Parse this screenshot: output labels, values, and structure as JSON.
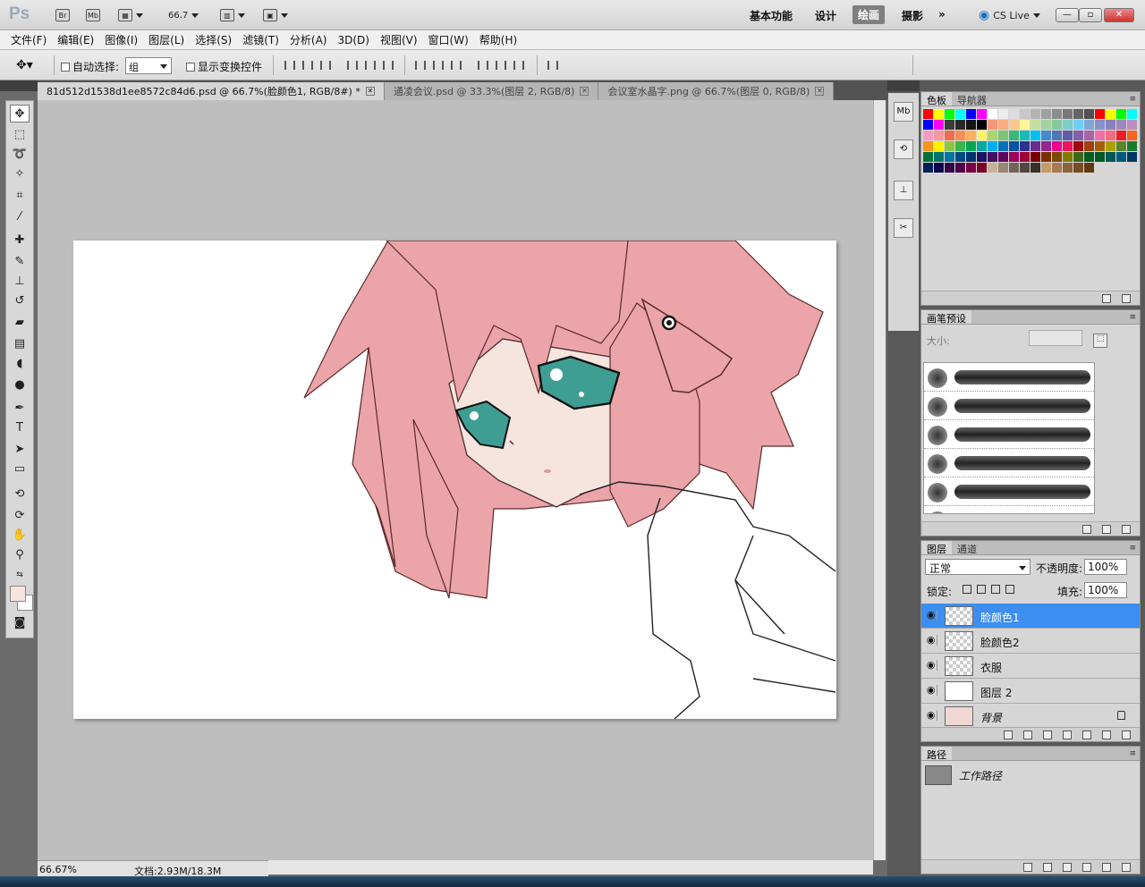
{
  "app": {
    "logo": "Ps"
  },
  "appbar": {
    "bridge": "Br",
    "minibridge": "Mb",
    "zoom": "66.7",
    "workspaces": [
      "基本功能",
      "设计",
      "绘画",
      "摄影"
    ],
    "active_workspace": "绘画",
    "more": "»",
    "cslive": "CS Live",
    "min": "—",
    "restore": "▫",
    "close": "✕"
  },
  "menu": [
    "文件(F)",
    "编辑(E)",
    "图像(I)",
    "图层(L)",
    "选择(S)",
    "滤镜(T)",
    "分析(A)",
    "3D(D)",
    "视图(V)",
    "窗口(W)",
    "帮助(H)"
  ],
  "options": {
    "auto_select_label": "自动选择:",
    "auto_select_value": "组",
    "show_transform_label": "显示变换控件"
  },
  "tabs": [
    {
      "label": "81d512d1538d1ee8572c84d6.psd @ 66.7%(脸颜色1, RGB/8#) *",
      "active": true
    },
    {
      "label": "通凌会议.psd @ 33.3%(图层 2, RGB/8)",
      "active": false
    },
    {
      "label": "会议室水晶字.png @ 66.7%(图层 0, RGB/8)",
      "active": false
    }
  ],
  "status": {
    "zoom": "66.67%",
    "doc": "文档:2.93M/18.3M"
  },
  "colors": {
    "hair": "#eba4a8",
    "skin": "#f6e4de",
    "eye": "#3f9e94",
    "selection": "#3d8ef0",
    "foreground": "#f6e4de"
  },
  "panels": {
    "swatches_tab": "色板",
    "navigator_tab": "导航器",
    "brush_tab": "画笔预设",
    "brush_size_label": "大小:",
    "layers_tab": "图层",
    "channels_tab": "通道",
    "blend_mode": "正常",
    "opacity_label": "不透明度:",
    "opacity": "100%",
    "lock_label": "锁定:",
    "fill_label": "填充:",
    "fill": "100%",
    "paths_tab": "路径",
    "path_name": "工作路径"
  },
  "layers": [
    {
      "name": "脸颜色1",
      "selected": true,
      "thumb": "transparent"
    },
    {
      "name": "脸颜色2",
      "selected": false,
      "thumb": "transparent"
    },
    {
      "name": "衣服",
      "selected": false,
      "thumb": "transparent"
    },
    {
      "name": "图层 2",
      "selected": false,
      "thumb": "white"
    },
    {
      "name": "背景",
      "selected": false,
      "thumb": "art",
      "locked": true
    }
  ],
  "swatch_colors": [
    "#ff0000",
    "#ffff00",
    "#00ff00",
    "#00ffff",
    "#0000ff",
    "#ff00ff",
    "#ffffff",
    "#ececec",
    "#dcdcdc",
    "#c8c8c8",
    "#b4b4b4",
    "#a0a0a0",
    "#8c8c8c",
    "#787878",
    "#646464",
    "#505050",
    "#ff0000",
    "#ffff00",
    "#00ff00",
    "#00ffff",
    "#0000ff",
    "#ff00ff",
    "#3c3c3c",
    "#282828",
    "#141414",
    "#000000",
    "#f7977a",
    "#f9ad81",
    "#fdc68a",
    "#fff79a",
    "#c4df9b",
    "#a2d39c",
    "#82ca9d",
    "#7bcdc8",
    "#6ecff6",
    "#7ea7d8",
    "#8493ca",
    "#8882be",
    "#a187be",
    "#bc8dbf",
    "#f49ac2",
    "#f6989d",
    "#f26c4f",
    "#f68e55",
    "#fbaf5c",
    "#fff467",
    "#acd372",
    "#7cc576",
    "#3bb878",
    "#1abbb4",
    "#00bff3",
    "#438ccb",
    "#5574b9",
    "#605ca8",
    "#855fa8",
    "#a763a8",
    "#f06eaa",
    "#f26d7d",
    "#ed1c24",
    "#f26522",
    "#f7941d",
    "#fff200",
    "#8dc63f",
    "#39b54a",
    "#00a651",
    "#00a99d",
    "#00aeef",
    "#0072bc",
    "#0054a6",
    "#2e3192",
    "#662d91",
    "#92278f",
    "#ec008c",
    "#ed145b",
    "#9e0b0f",
    "#a0410d",
    "#a3620a",
    "#aba000",
    "#598527",
    "#1a7b30",
    "#007236",
    "#00746b",
    "#0076a3",
    "#004b80",
    "#003471",
    "#1b1464",
    "#440e62",
    "#630460",
    "#9e005d",
    "#9e0039",
    "#790000",
    "#7b2e00",
    "#7d4900",
    "#827b00",
    "#406618",
    "#005e20",
    "#005826",
    "#005952",
    "#005b7f",
    "#003663",
    "#002157",
    "#0d004c",
    "#32004b",
    "#4b0049",
    "#7b0046",
    "#7a0026",
    "#c7b299",
    "#998675",
    "#736357",
    "#534741",
    "#37302d",
    "#c69c6d",
    "#a67c52",
    "#8c6239",
    "#754c24",
    "#603913"
  ]
}
